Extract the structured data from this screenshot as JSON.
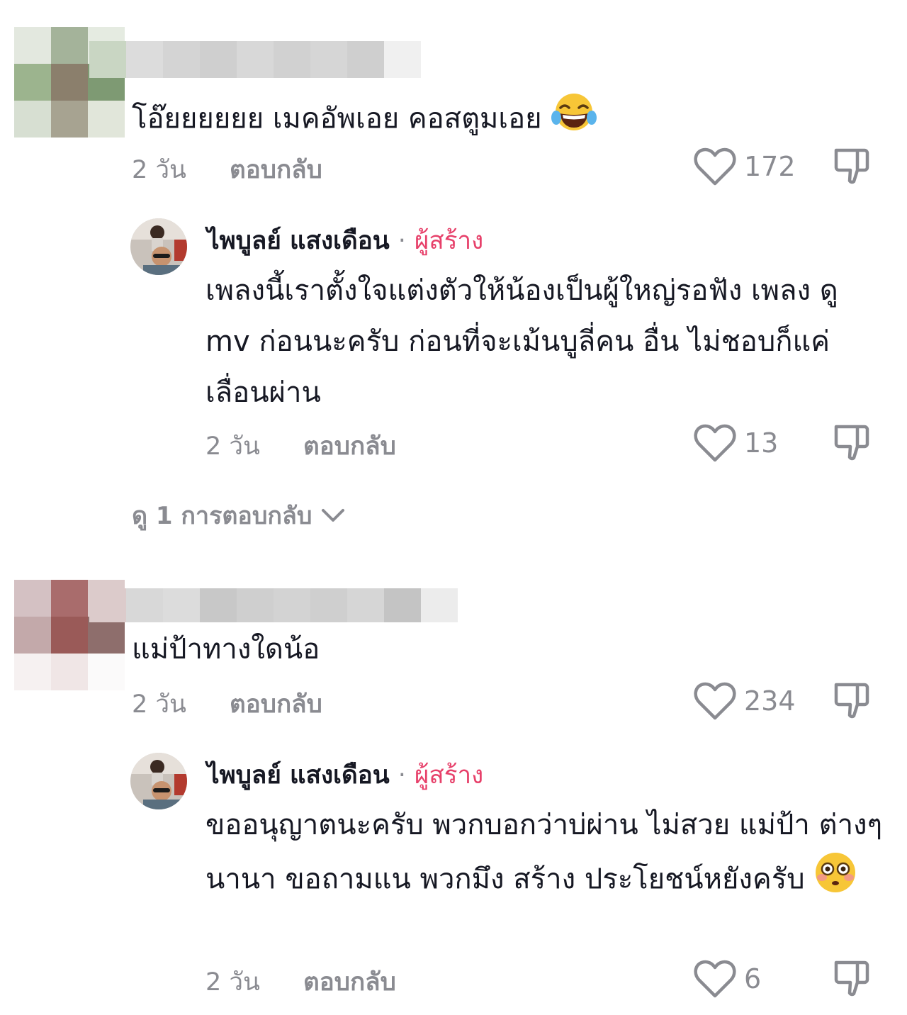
{
  "comments": [
    {
      "text": "โอ๊ยยยยยย เมคอัพเอย คอสตูมเอย",
      "emoji": "laughing-tears-emoji",
      "time": "2 วัน",
      "reply_label": "ตอบกลับ",
      "likes": "172",
      "reply": {
        "author": "ไพบูลย์ แสงเดือน",
        "dot": "·",
        "badge": "ผู้สร้าง",
        "text": "เพลงนี้เราตั้งใจแต่งตัวให้น้องเป็นผู้ใหญ่รอฟัง เพลง ดู mv ก่อนนะครับ ก่อนที่จะเม้นบูลี่คน อื่น ไม่ชอบก็แค่เลื่อนผ่าน",
        "time": "2 วัน",
        "reply_label": "ตอบกลับ",
        "likes": "13"
      },
      "view_replies": "ดู 1 การตอบกลับ"
    },
    {
      "text": "แม่ป้าทางใดน้อ",
      "time": "2 วัน",
      "reply_label": "ตอบกลับ",
      "likes": "234",
      "reply": {
        "author": "ไพบูลย์ แสงเดือน",
        "dot": "·",
        "badge": "ผู้สร้าง",
        "text": "ขออนุญาตนะครับ พวกบอกว่าบ่ผ่าน ไม่สวย แม่ป้า ต่างๆนานา ขอถามแน พวกมึง สร้าง ประโยชน์หยังครับ",
        "emoji": "flushed-face-emoji",
        "time": "2 วัน",
        "reply_label": "ตอบกลับ",
        "likes": "6"
      }
    }
  ],
  "colors": {
    "text": "#161823",
    "secondary": "#8a8b91",
    "creator_badge": "#e7406a"
  }
}
